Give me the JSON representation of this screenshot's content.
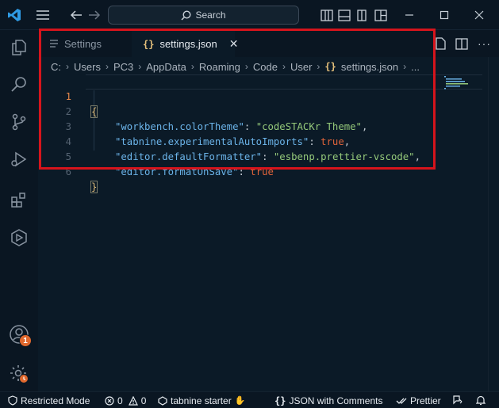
{
  "titlebar": {
    "search_label": "Search"
  },
  "activity": {
    "badge_count": "1"
  },
  "tabs": [
    {
      "label": "Settings"
    },
    {
      "label": "settings.json",
      "icon_text": "{}"
    }
  ],
  "breadcrumb": {
    "items": [
      "C:",
      "Users",
      "PC3",
      "AppData",
      "Roaming",
      "Code",
      "User"
    ],
    "file_icon_text": "{}",
    "file": "settings.json",
    "more": "..."
  },
  "editor": {
    "lines": [
      {
        "num": "1",
        "open": "{"
      },
      {
        "num": "2",
        "key": "\"workbench.colorTheme\"",
        "colon": ": ",
        "val": "\"codeSTACKr Theme\"",
        "comma": ","
      },
      {
        "num": "3",
        "key": "\"tabnine.experimentalAutoImports\"",
        "colon": ": ",
        "val": "true",
        "comma": ","
      },
      {
        "num": "4",
        "key": "\"editor.defaultFormatter\"",
        "colon": ": ",
        "val": "\"esbenp.prettier-vscode\"",
        "comma": ","
      },
      {
        "num": "5",
        "key": "\"editor.formatOnSave\"",
        "colon": ": ",
        "val": "true"
      },
      {
        "num": "6",
        "close": "}"
      }
    ]
  },
  "statusbar": {
    "restricted": "Restricted Mode",
    "errors": "0",
    "warnings": "0",
    "tabnine": "tabnine starter",
    "language_icon_text": "{}",
    "language": "JSON with Comments",
    "prettier": "Prettier"
  },
  "colors": {
    "highlight_box": "#d6141c",
    "badge": "#e0682d",
    "background": "#0b1a27"
  },
  "icons": [
    "vscode-logo-icon",
    "menu-icon",
    "back-arrow-icon",
    "forward-arrow-icon",
    "search-icon",
    "toggle-panel-icon",
    "toggle-sidebar-icon",
    "toggle-secondary-sidebar-icon",
    "layout-icon",
    "minimize-icon",
    "maximize-icon",
    "close-icon",
    "explorer-icon",
    "search-view-icon",
    "source-control-icon",
    "run-debug-icon",
    "extensions-icon",
    "remote-explorer-icon",
    "accounts-icon",
    "manage-gear-icon",
    "shield-icon",
    "error-icon",
    "warning-icon",
    "tabnine-icon",
    "double-check-icon",
    "feedback-icon",
    "bell-icon",
    "file-icon",
    "split-editor-icon"
  ]
}
